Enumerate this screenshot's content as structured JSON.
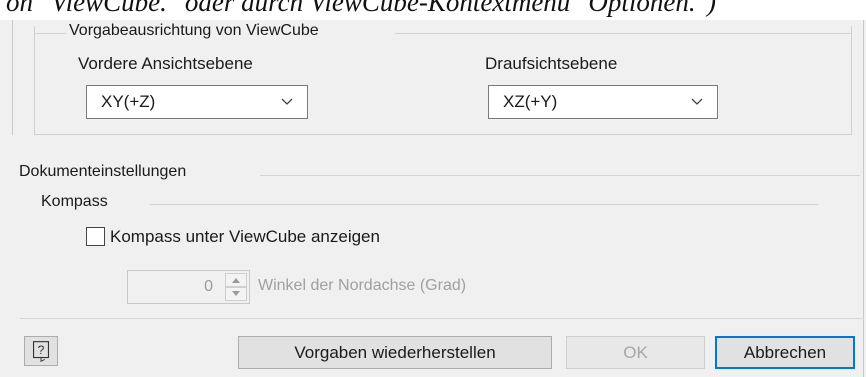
{
  "header_snippet": "on \"ViewCube.\" oder durch ViewCube-Kontextmenü \"Optionen.\")",
  "viewcube_group": {
    "title": "Vorgabeausrichtung von ViewCube",
    "front_label": "Vordere Ansichtsebene",
    "front_value": "XY(+Z)",
    "top_label": "Draufsichtsebene",
    "top_value": "XZ(+Y)"
  },
  "document_group": {
    "title": "Dokumenteinstellungen",
    "compass_group_title": "Kompass",
    "show_compass_label": "Kompass unter ViewCube anzeigen",
    "show_compass_checked": false,
    "north_angle_value": "0",
    "north_angle_label": "Winkel der Nordachse (Grad)"
  },
  "footer": {
    "restore_label": "Vorgaben wiederherstellen",
    "ok_label": "OK",
    "cancel_label": "Abbrechen"
  },
  "icons": [
    "help-icon",
    "chevron-down-icon",
    "spin-up-icon",
    "spin-down-icon"
  ],
  "colors": {
    "default_button_border": "#0078d7",
    "dialog_bg": "#f0f0f0"
  }
}
